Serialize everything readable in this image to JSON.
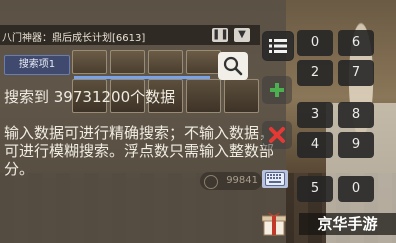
{
  "window": {
    "title": "八门神器：鼎后成长计划[6613]",
    "pause_icon": "pause-icon",
    "collapse_icon": "collapse-down-icon"
  },
  "search": {
    "tab_label": "搜索项1",
    "result_text": "搜索到 39731200个数据",
    "help_text": "输入数据可进行精确搜索；不输入数据，可进行模糊搜索。浮点数只需输入整数部分。",
    "value_placeholder": "99841",
    "progress_fraction": 1.0,
    "accent_color": "#7aa2e8"
  },
  "side_buttons": {
    "list_icon": "list-icon",
    "add_icon": "plus-icon",
    "delete_icon": "delete-x-icon",
    "keyboard_icon": "keyboard-icon",
    "add_color": "#4caf50",
    "delete_color": "#e53935"
  },
  "keypad": {
    "keys": [
      "0",
      "6",
      "2",
      "7",
      "3",
      "8",
      "4",
      "9",
      "5",
      "0"
    ]
  },
  "overlay": {
    "watermark": "京华手游",
    "gift_icon": "gift-box-icon"
  }
}
